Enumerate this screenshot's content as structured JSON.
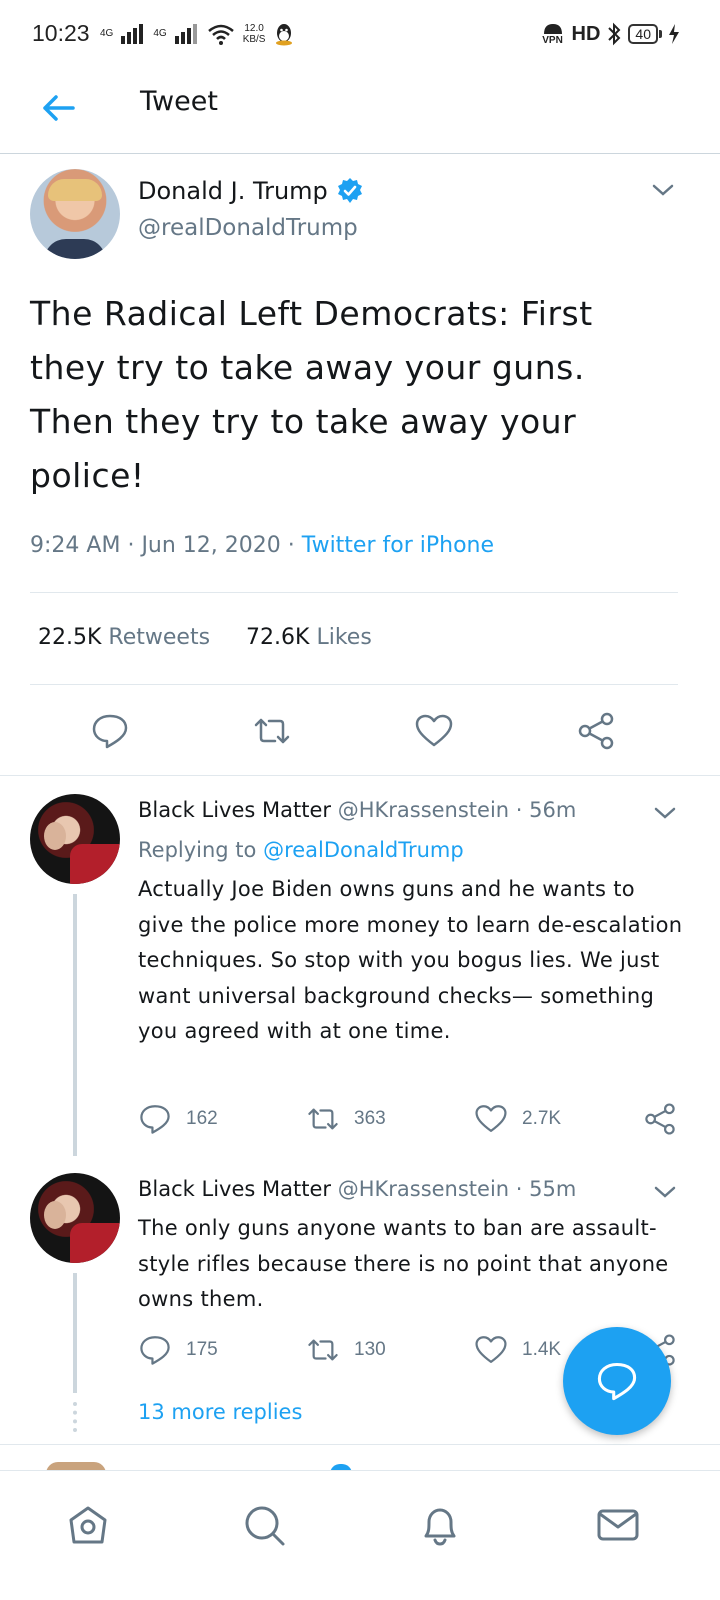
{
  "status_bar": {
    "time": "10:23",
    "network_1": "4G",
    "network_2": "4G",
    "speed_value": "12.0",
    "speed_unit": "KB/S",
    "vpn_label": "VPN",
    "hd_label": "HD",
    "battery": "40",
    "icons": [
      "signal-icon",
      "wifi-icon",
      "qq-icon",
      "vpn-icon",
      "bluetooth-icon",
      "battery-icon",
      "charging-icon"
    ]
  },
  "header": {
    "title": "Tweet"
  },
  "main_tweet": {
    "name": "Donald J. Trump",
    "handle": "@realDonaldTrump",
    "text": "The Radical Left Democrats: First they try to take away your guns. Then they try to take away your police!",
    "time": "9:24 AM",
    "date": "Jun 12, 2020",
    "source": "Twitter for iPhone",
    "retweets_count": "22.5K",
    "retweets_label": "Retweets",
    "likes_count": "72.6K",
    "likes_label": "Likes"
  },
  "replies": [
    {
      "name": "Black Lives Matter",
      "handle": "@HKrassenstein",
      "time": "56m",
      "replying_label": "Replying to",
      "replying_to": "@realDonaldTrump",
      "text": "Actually Joe Biden owns guns and he wants to give the police more money to learn de-escalation techniques.  So stop with you bogus lies.  We just want universal background checks— something you agreed with at one time.",
      "reply_count": "162",
      "retweet_count": "363",
      "like_count": "2.7K"
    },
    {
      "name": "Black Lives Matter",
      "handle": "@HKrassenstein",
      "time": "55m",
      "text": "The only guns anyone wants to ban are assault-style rifles because there is no point that anyone owns them.",
      "reply_count": "175",
      "retweet_count": "130",
      "like_count": "1.4K"
    }
  ],
  "more_replies": "13 more replies",
  "bottom_nav": [
    "home-icon",
    "search-icon",
    "notifications-icon",
    "messages-icon"
  ],
  "colors": {
    "accent": "#1da1f2",
    "secondary_text": "#657786",
    "primary_text": "#14171a",
    "divider": "#e1e8ed"
  }
}
